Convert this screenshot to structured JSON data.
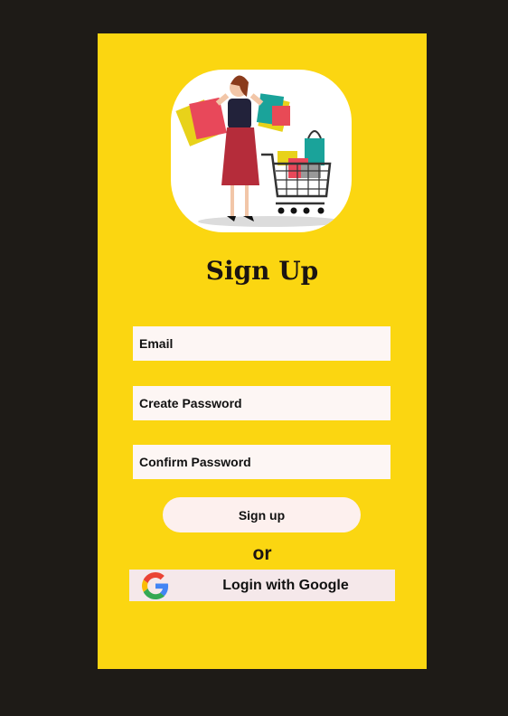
{
  "page": {
    "background_color": "#1e1b17",
    "card_color": "#fbd611"
  },
  "hero": {
    "illustration": "shopping-woman-with-bags-and-cart"
  },
  "title": "Sign Up",
  "form": {
    "email_placeholder": "Email",
    "password_placeholder": "Create Password",
    "confirm_placeholder": "Confirm Password",
    "signup_label": "Sign up"
  },
  "divider_text": "or",
  "google": {
    "icon": "google-g-icon",
    "label": "Login with Google"
  }
}
